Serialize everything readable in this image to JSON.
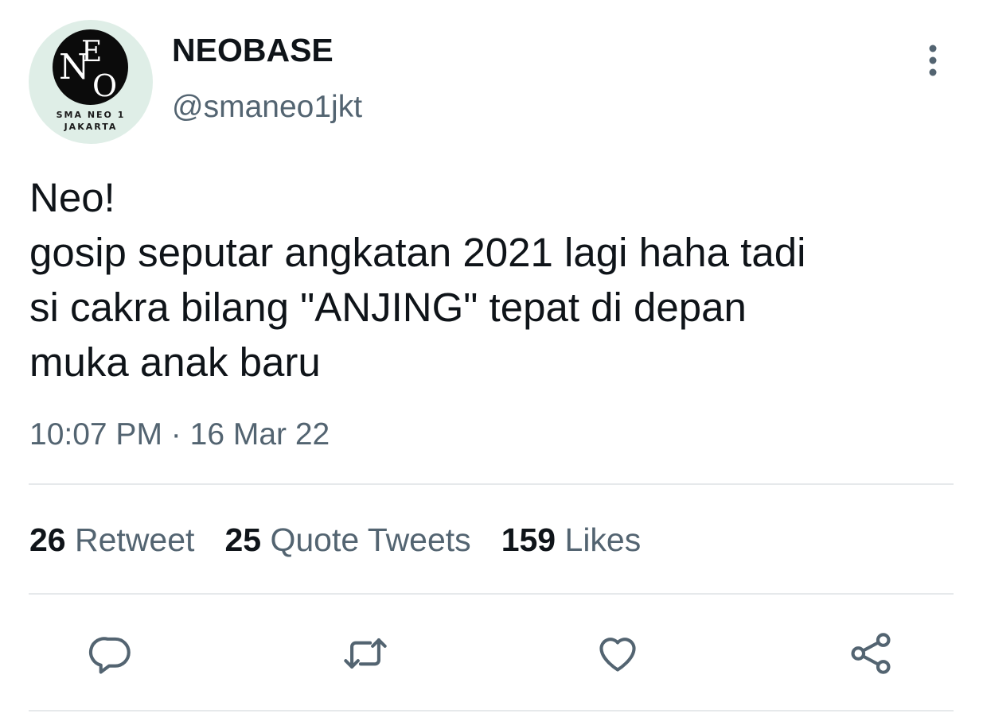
{
  "author": {
    "display_name": "NEOBASE",
    "handle": "@smaneo1jkt",
    "avatar": {
      "logo_letters": [
        "N",
        "E",
        "O"
      ],
      "caption_line1": "SMA NEO 1",
      "caption_line2": "JAKARTA"
    }
  },
  "tweet": {
    "text_lines": [
      "Neo!",
      "gosip seputar angkatan 2021 lagi haha tadi",
      "si cakra bilang \"ANJING\" tepat di depan",
      "muka anak baru"
    ],
    "time": "10:07 PM",
    "separator": "·",
    "date": "16 Mar 22"
  },
  "stats": {
    "retweets": {
      "count": "26",
      "label": "Retweet"
    },
    "quotes": {
      "count": "25",
      "label": "Quote Tweets"
    },
    "likes": {
      "count": "159",
      "label": "Likes"
    }
  },
  "icons": {
    "more": "more-vertical-icon",
    "reply": "reply-icon",
    "retweet": "retweet-icon",
    "like": "heart-icon",
    "share": "share-icon"
  },
  "colors": {
    "text_primary": "#0f1419",
    "text_secondary": "#536471",
    "divider": "#e6e9eb",
    "avatar_background": "#dfeee7"
  }
}
